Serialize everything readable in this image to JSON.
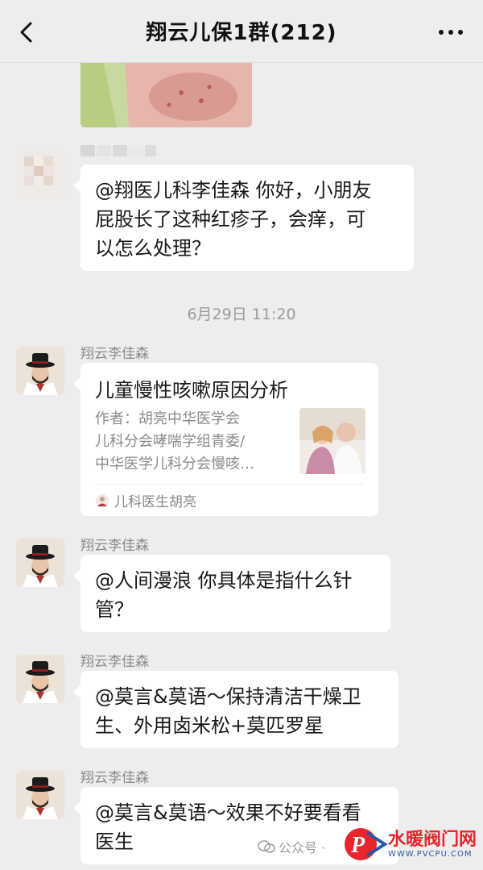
{
  "header": {
    "title": "翔云儿保1群(212)"
  },
  "messages": [
    {
      "sender": "",
      "text": "@翔医儿科李佳森 你好，小朋友\n屁股长了这种红疹子，会痒，可\n以怎么处理？"
    },
    {
      "timestamp": "6月29日 11:20"
    },
    {
      "sender": "翔云李佳森",
      "card": {
        "title": "儿童慢性咳嗽原因分析",
        "desc": "作者：胡亮中华医学会\n儿科分会哮喘学组青委/\n中华医学儿科分会慢咳…",
        "source": "儿科医生胡亮"
      }
    },
    {
      "sender": "翔云李佳森",
      "text": "@人间漫浪 你具体是指什么针\n管？"
    },
    {
      "sender": "翔云李佳森",
      "text": "@莫言&莫语～保持清洁干燥卫\n生、外用卤米松+莫匹罗星"
    },
    {
      "sender": "翔云李佳森",
      "text": "@莫言&莫语～效果不好要看看\n医生"
    }
  ],
  "watermark": {
    "text": "公众号 · "
  },
  "logo": {
    "text": "水暖阀门网",
    "url": "WWW.PVCPU.COM"
  },
  "colors": {
    "background": "#ededed",
    "bubble": "#ffffff",
    "logo_red": "#e8252d"
  }
}
